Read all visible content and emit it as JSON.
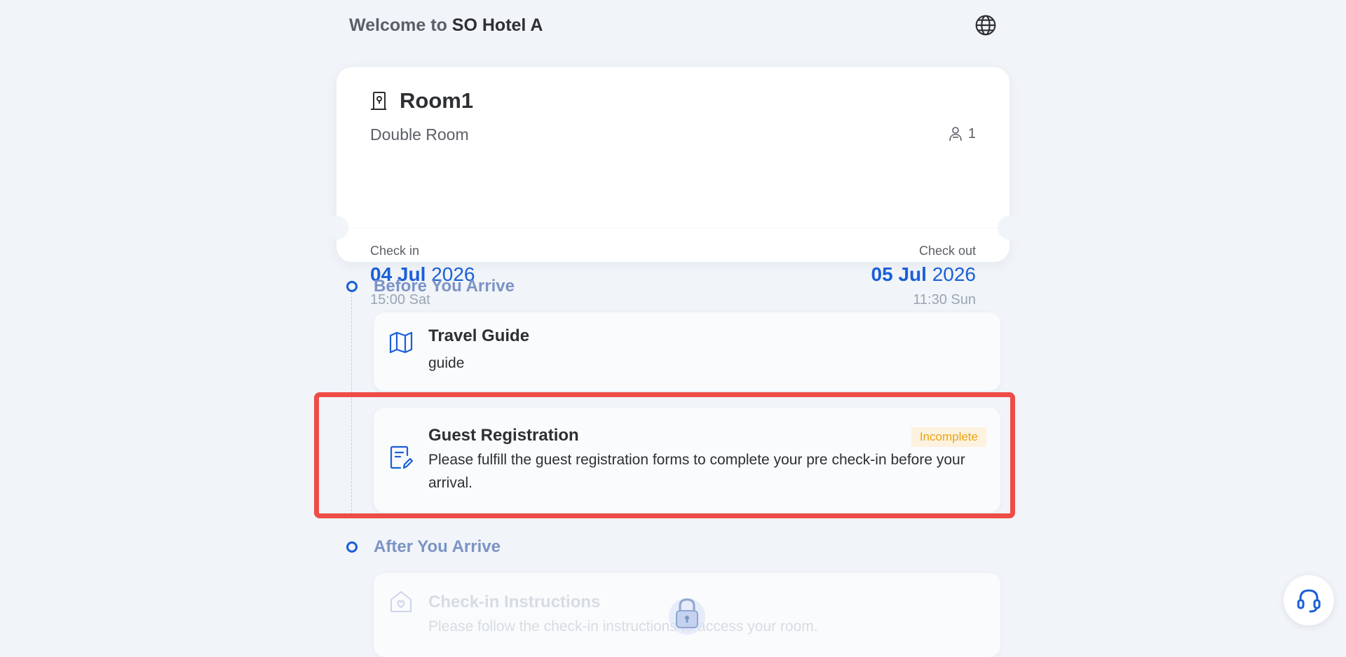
{
  "header": {
    "welcome_prefix": "Welcome to",
    "hotel_name": "SO Hotel A",
    "language_icon": "globe-icon"
  },
  "room": {
    "name": "Room1",
    "type": "Double Room",
    "guests": "1",
    "room_icon": "door-location-icon",
    "guest_icon": "person-icon",
    "check_in": {
      "label": "Check in",
      "day_month": "04 Jul",
      "year": "2026",
      "time": "15:00 Sat"
    },
    "check_out": {
      "label": "Check out",
      "day_month": "05 Jul",
      "year": "2026",
      "time": "11:30 Sun"
    }
  },
  "sections": {
    "before": {
      "title": "Before You Arrive",
      "tasks": [
        {
          "title": "Travel Guide",
          "description": "guide",
          "icon": "map-icon"
        },
        {
          "title": "Guest Registration",
          "description": "Please fulfill the guest registration forms to complete your pre check-in before your arrival.",
          "status": "Incomplete",
          "icon": "form-edit-icon"
        }
      ]
    },
    "after": {
      "title": "After You Arrive",
      "tasks": [
        {
          "title": "Check-in Instructions",
          "description": "Please follow the check-in instructions to access your room.",
          "icon": "home-heart-icon",
          "locked": true
        }
      ]
    }
  },
  "support_icon": "headset-icon",
  "colors": {
    "accent": "#1a5fd8",
    "background": "#f1f4f8",
    "section_title": "#7b93c6",
    "badge_text": "#e8a410",
    "badge_bg": "#fdf2df",
    "highlight": "#ee4c48"
  }
}
